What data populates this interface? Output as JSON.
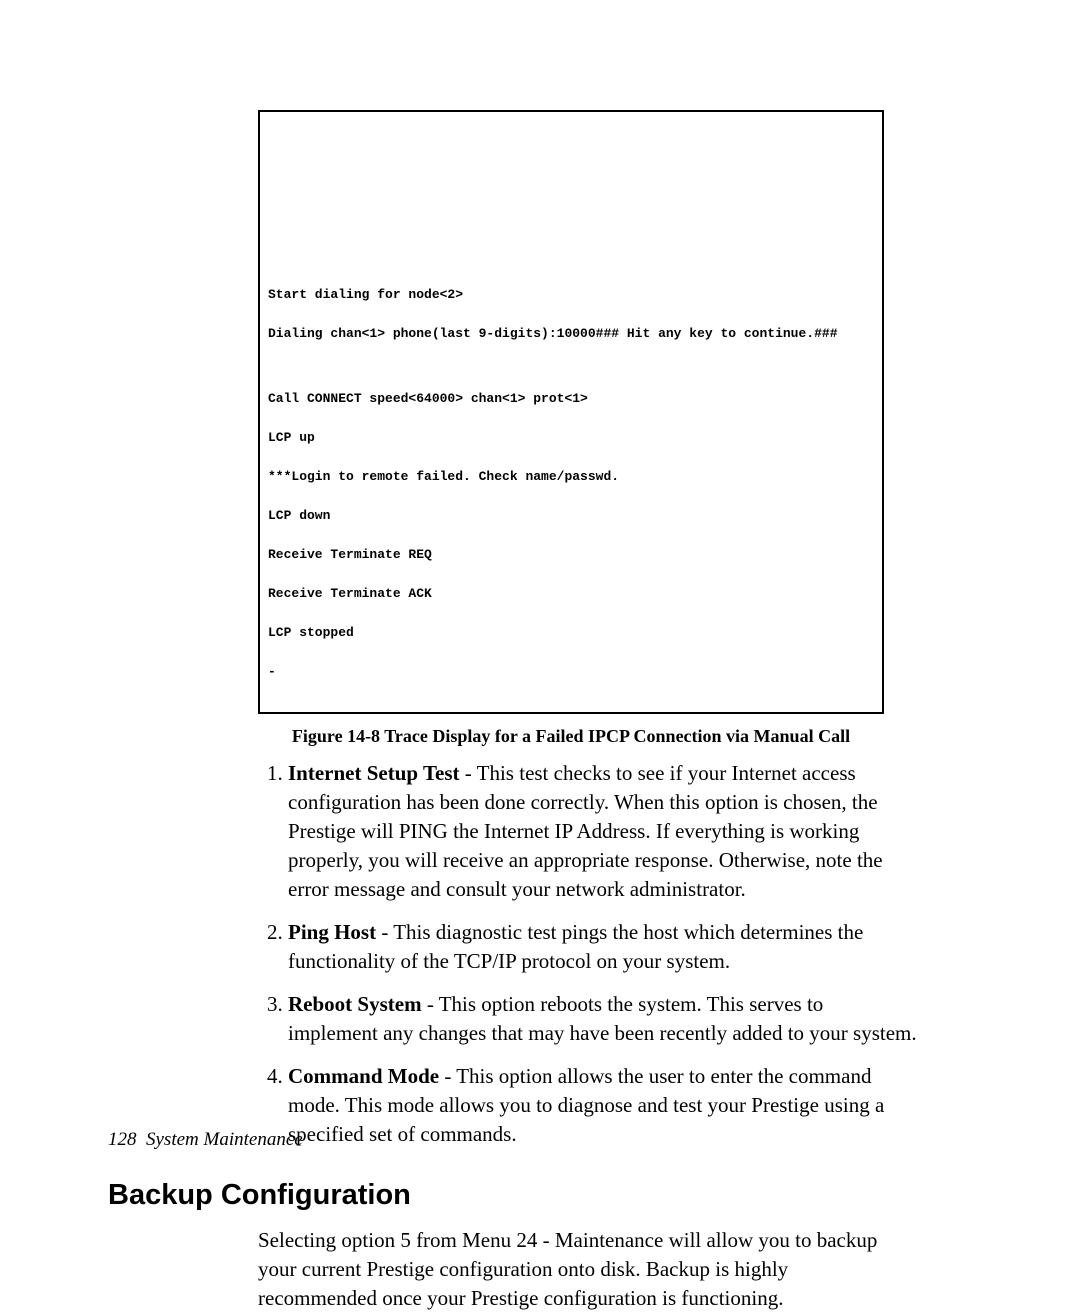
{
  "trace": {
    "lines": [
      "Start dialing for node<2>",
      "Dialing chan<1> phone(last 9-digits):10000### Hit any key to continue.###",
      "",
      "Call CONNECT speed<64000> chan<1> prot<1>",
      "LCP up",
      "***Login to remote failed. Check name/passwd.",
      "LCP down",
      "Receive Terminate REQ",
      "Receive Terminate ACK",
      "LCP stopped",
      "-"
    ]
  },
  "caption": "Figure 14-8 Trace Display for a Failed IPCP Connection via Manual Call",
  "list": [
    {
      "title": "Internet Setup Test",
      "body": " - This test checks to see if your Internet access configuration has been done correctly. When this option is chosen, the Prestige will PING the Internet IP Address. If everything is working properly, you will receive an appropriate response. Otherwise, note the error message and consult your network administrator."
    },
    {
      "title": "Ping Host",
      "body": " - This diagnostic test pings the host which determines the functionality of the TCP/IP protocol on your system."
    },
    {
      "title": "Reboot System",
      "body": " - This option reboots the system. This serves to implement any changes that may have been recently added to your system."
    },
    {
      "title": "Command Mode",
      "body": " - This option allows the user to enter the command mode. This mode allows you to diagnose and test your Prestige using a specified set of commands."
    }
  ],
  "section_heading": "Backup Configuration",
  "section_body": "Selecting option 5 from Menu 24 - Maintenance will allow you to backup your current Prestige configuration onto disk. Backup is highly recommended once your Prestige configuration is functioning.",
  "footer": {
    "page": "128",
    "label": "System Maintenance"
  }
}
